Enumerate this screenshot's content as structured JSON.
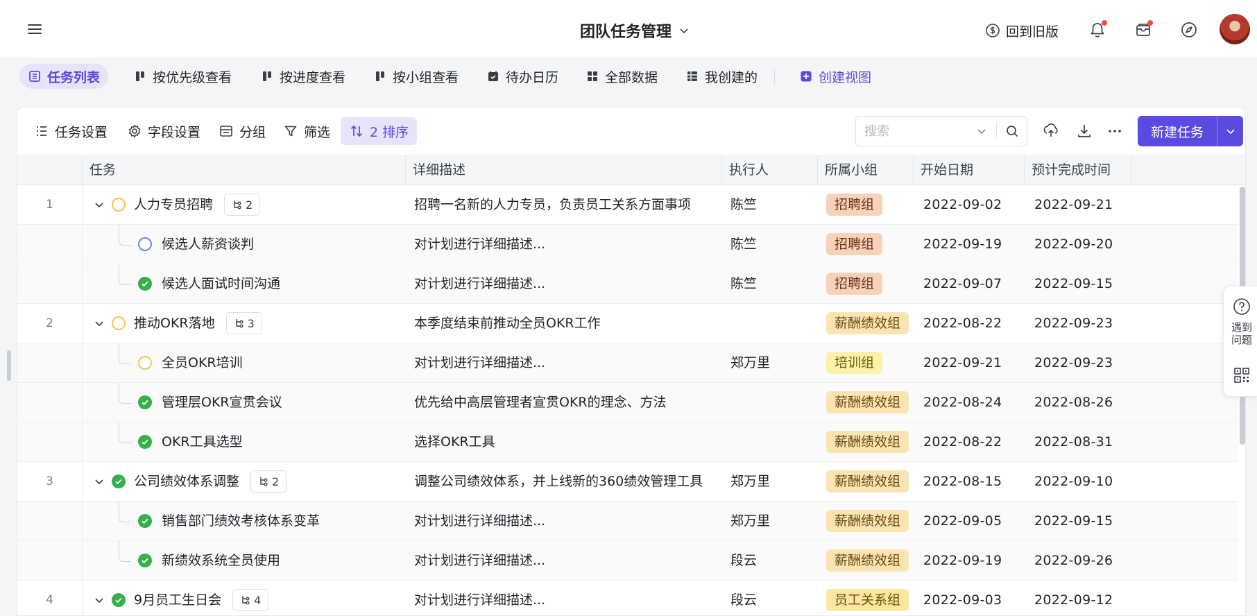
{
  "header": {
    "title": "团队任务管理",
    "old_version": "回到旧版"
  },
  "views": {
    "tabs": [
      {
        "label": "任务列表",
        "active": true
      },
      {
        "label": "按优先级查看"
      },
      {
        "label": "按进度查看"
      },
      {
        "label": "按小组查看"
      },
      {
        "label": "待办日历"
      },
      {
        "label": "全部数据"
      },
      {
        "label": "我创建的"
      }
    ],
    "create": "创建视图"
  },
  "toolbar": {
    "task_settings": "任务设置",
    "field_settings": "字段设置",
    "group": "分组",
    "filter": "筛选",
    "sort": "2 排序",
    "search_placeholder": "搜索",
    "new_task": "新建任务"
  },
  "table": {
    "columns": [
      "任务",
      "详细描述",
      "执行人",
      "所属小组",
      "开始日期",
      "预计完成时间"
    ],
    "rows": [
      {
        "index": "1",
        "name": "人力专员招聘",
        "subcount": "2",
        "status": "yellow",
        "desc": "招聘一名新的人力专员，负责员工关系方面事项",
        "owner": "陈竺",
        "group": "招聘组",
        "start": "2022-09-02",
        "due": "2022-09-21"
      },
      {
        "name": "候选人薪资谈判",
        "status": "blue",
        "desc": "对计划进行详细描述...",
        "owner": "陈竺",
        "group": "招聘组",
        "start": "2022-09-19",
        "due": "2022-09-20"
      },
      {
        "name": "候选人面试时间沟通",
        "status": "done",
        "desc": "对计划进行详细描述...",
        "owner": "陈竺",
        "group": "招聘组",
        "start": "2022-09-07",
        "due": "2022-09-15"
      },
      {
        "index": "2",
        "name": "推动OKR落地",
        "subcount": "3",
        "status": "yellow",
        "desc": "本季度结束前推动全员OKR工作",
        "owner": "",
        "group": "薪酬绩效组",
        "start": "2022-08-22",
        "due": "2022-09-23"
      },
      {
        "name": "全员OKR培训",
        "status": "yellow",
        "desc": "对计划进行详细描述...",
        "owner": "郑万里",
        "group": "培训组",
        "start": "2022-09-21",
        "due": "2022-09-23"
      },
      {
        "name": "管理层OKR宣贯会议",
        "status": "done",
        "desc": "优先给中高层管理者宣贯OKR的理念、方法",
        "owner": "",
        "group": "薪酬绩效组",
        "start": "2022-08-24",
        "due": "2022-08-26"
      },
      {
        "name": "OKR工具选型",
        "status": "done",
        "desc": "选择OKR工具",
        "owner": "",
        "group": "薪酬绩效组",
        "start": "2022-08-22",
        "due": "2022-08-31"
      },
      {
        "index": "3",
        "name": "公司绩效体系调整",
        "subcount": "2",
        "status": "done",
        "desc": "调整公司绩效体系，并上线新的360绩效管理工具",
        "owner": "郑万里",
        "group": "薪酬绩效组",
        "start": "2022-08-15",
        "due": "2022-09-10"
      },
      {
        "name": "销售部门绩效考核体系变革",
        "status": "done",
        "desc": "对计划进行详细描述...",
        "owner": "郑万里",
        "group": "薪酬绩效组",
        "start": "2022-09-05",
        "due": "2022-09-15"
      },
      {
        "name": "新绩效系统全员使用",
        "status": "done",
        "desc": "对计划进行详细描述...",
        "owner": "段云",
        "group": "薪酬绩效组",
        "start": "2022-09-19",
        "due": "2022-09-26"
      },
      {
        "index": "4",
        "name": "9月员工生日会",
        "subcount": "4",
        "status": "done",
        "desc": "对计划进行详细描述...",
        "owner": "段云",
        "group": "员工关系组",
        "start": "2022-09-03",
        "due": "2022-09-12"
      }
    ]
  },
  "help": {
    "label": "遇到问题"
  },
  "colors": {
    "accent": "#5b4ae0",
    "done": "#36b04b",
    "pending": "#f5c451",
    "in_progress": "#5c8dea"
  }
}
